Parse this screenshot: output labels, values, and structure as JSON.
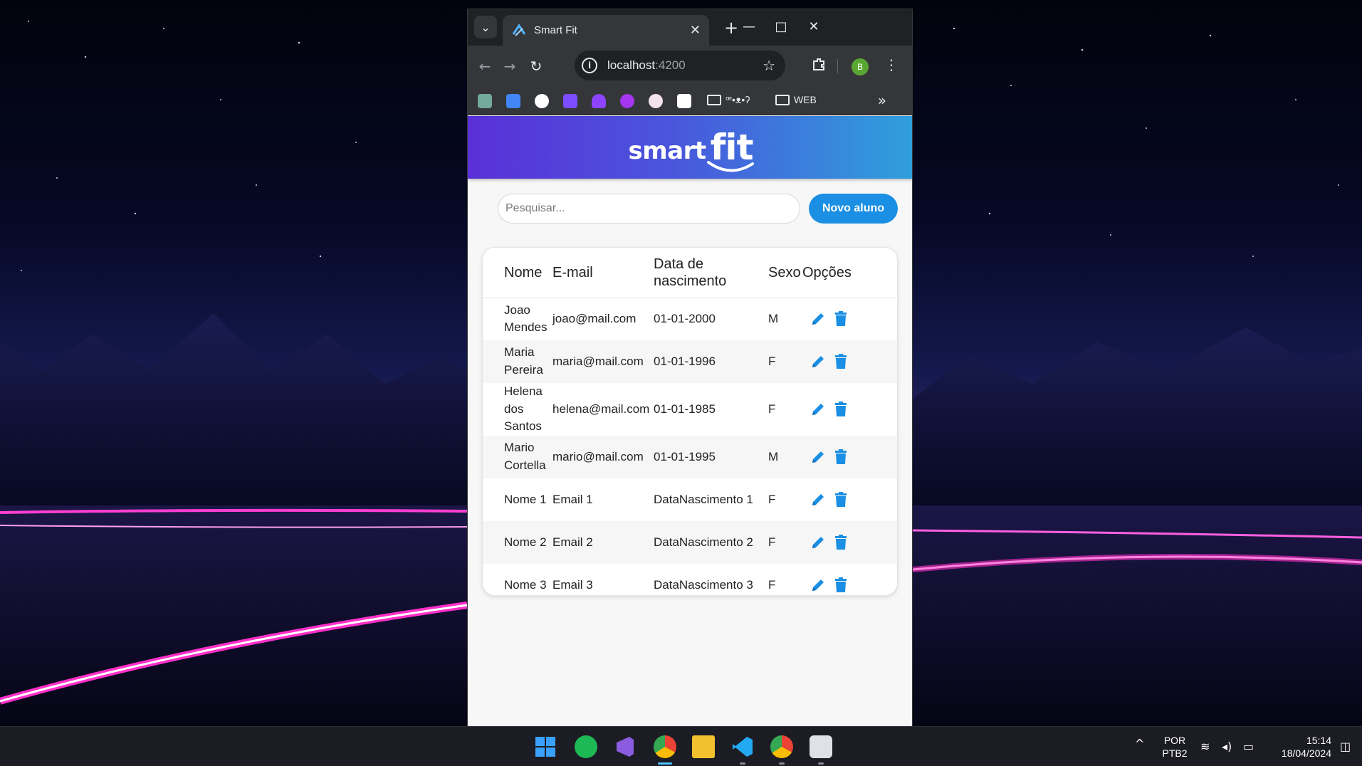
{
  "browser": {
    "tab_title": "Smart Fit",
    "url_host": "localhost",
    "url_port": ":4200",
    "profile_initial": "B",
    "bookmarks": [
      {
        "icon": "chatgpt-icon",
        "color": "#74aa9c"
      },
      {
        "icon": "calendar-icon",
        "color": "#4285f4"
      },
      {
        "icon": "github-icon",
        "color": "#ffffff"
      },
      {
        "icon": "bookmark-app-icon",
        "color": "#7c4dff"
      },
      {
        "icon": "fox-icon",
        "color": "#8e44ff"
      },
      {
        "icon": "udemy-icon",
        "color": "#a435f0"
      },
      {
        "icon": "brain-icon",
        "color": "#f4c2c2"
      },
      {
        "icon": "codepen-icon",
        "color": "#ffffff"
      }
    ],
    "folder_1": "ꟹ•ᴥ•ʔ",
    "folder_2": "WEB"
  },
  "app": {
    "logo_smart": "smart",
    "logo_fit": "fit",
    "search_placeholder": "Pesquisar...",
    "new_button": "Novo aluno",
    "columns": {
      "name": "Nome",
      "email": "E-mail",
      "birth": "Data de nascimento",
      "sex": "Sexo",
      "options": "Opções"
    },
    "rows": [
      {
        "name": "Joao Mendes",
        "email": "joao@mail.com",
        "birth": "01-01-2000",
        "sex": "M"
      },
      {
        "name": "Maria Pereira",
        "email": "maria@mail.com",
        "birth": "01-01-1996",
        "sex": "F"
      },
      {
        "name": "Helena dos Santos",
        "email": "helena@mail.com",
        "birth": "01-01-1985",
        "sex": "F"
      },
      {
        "name": "Mario Cortella",
        "email": "mario@mail.com",
        "birth": "01-01-1995",
        "sex": "M"
      },
      {
        "name": "Nome 1",
        "email": "Email 1",
        "birth": "DataNascimento 1",
        "sex": "F"
      },
      {
        "name": "Nome 2",
        "email": "Email 2",
        "birth": "DataNascimento 2",
        "sex": "F"
      },
      {
        "name": "Nome 3",
        "email": "Email 3",
        "birth": "DataNascimento 3",
        "sex": "F"
      }
    ],
    "action_color": "#1a8fe3",
    "header_gradient": [
      "#5a30d8",
      "#2fa0dc"
    ]
  },
  "taskbar": {
    "apps": [
      "windows-start-icon",
      "spotify-icon",
      "visual-studio-icon",
      "chrome-icon",
      "file-explorer-icon",
      "vscode-icon",
      "chrome-icon",
      "snipping-tool-icon"
    ],
    "lang_top": "POR",
    "lang_bottom": "PTB2",
    "time": "15:14",
    "date": "18/04/2024"
  }
}
